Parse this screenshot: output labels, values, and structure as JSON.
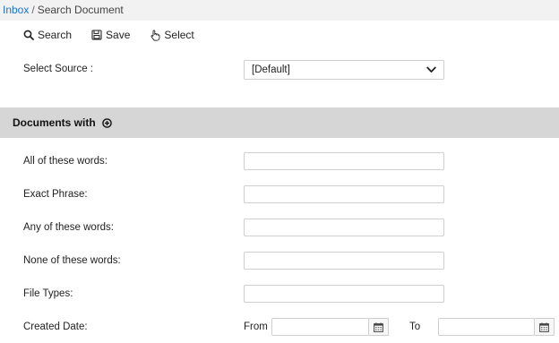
{
  "breadcrumb": {
    "root": "Inbox",
    "separator": "/",
    "current": "Search Document"
  },
  "toolbar": {
    "search": "Search",
    "save": "Save",
    "select": "Select"
  },
  "source": {
    "label": "Select Source :",
    "value": "[Default]"
  },
  "section": {
    "title": "Documents with"
  },
  "fields": {
    "all_words": "All of these words:",
    "exact_phrase": "Exact Phrase:",
    "any_words": "Any of these words:",
    "none_words": "None of these words:",
    "file_types": "File Types:",
    "created_date": "Created Date:"
  },
  "date_range": {
    "from": "From",
    "to": "To"
  },
  "colors": {
    "link": "#1a73c7",
    "section_bg": "#d6d6d6",
    "breadcrumb_bg": "#f2f2f2"
  }
}
